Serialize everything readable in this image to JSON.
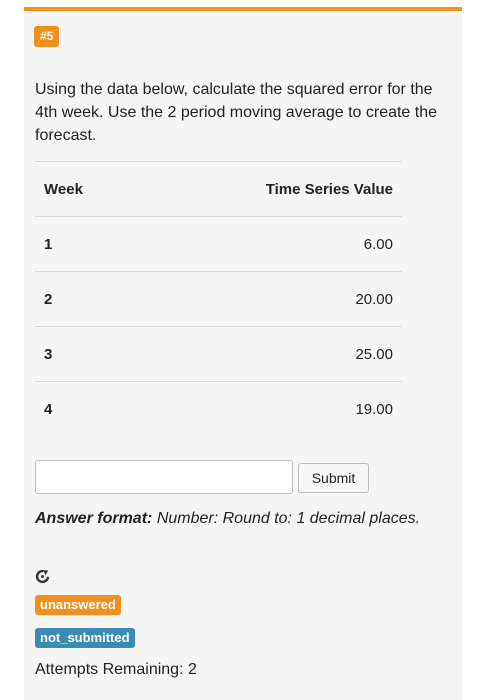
{
  "problem": {
    "number_badge": "#5",
    "question": "Using the data below, calculate the squared error for the 4th week. Use the 2 period moving average to create the forecast."
  },
  "table": {
    "headers": [
      "Week",
      "Time Series Value"
    ],
    "rows": [
      {
        "week": "1",
        "value": "6.00"
      },
      {
        "week": "2",
        "value": "20.00"
      },
      {
        "week": "3",
        "value": "25.00"
      },
      {
        "week": "4",
        "value": "19.00"
      }
    ]
  },
  "answer": {
    "input_value": "",
    "submit_label": "Submit",
    "format_label": "Answer format:",
    "format_text": "Number: Round to: 1 decimal places."
  },
  "status": {
    "answer_badge": "unanswered",
    "submission_badge": "not_submitted",
    "attempts": "Attempts Remaining: 2"
  },
  "colors": {
    "accent": "#f0901e",
    "info": "#3b8cb5",
    "panel_bg": "#f5f5f5"
  },
  "icons": {
    "reset": "reset-icon"
  }
}
